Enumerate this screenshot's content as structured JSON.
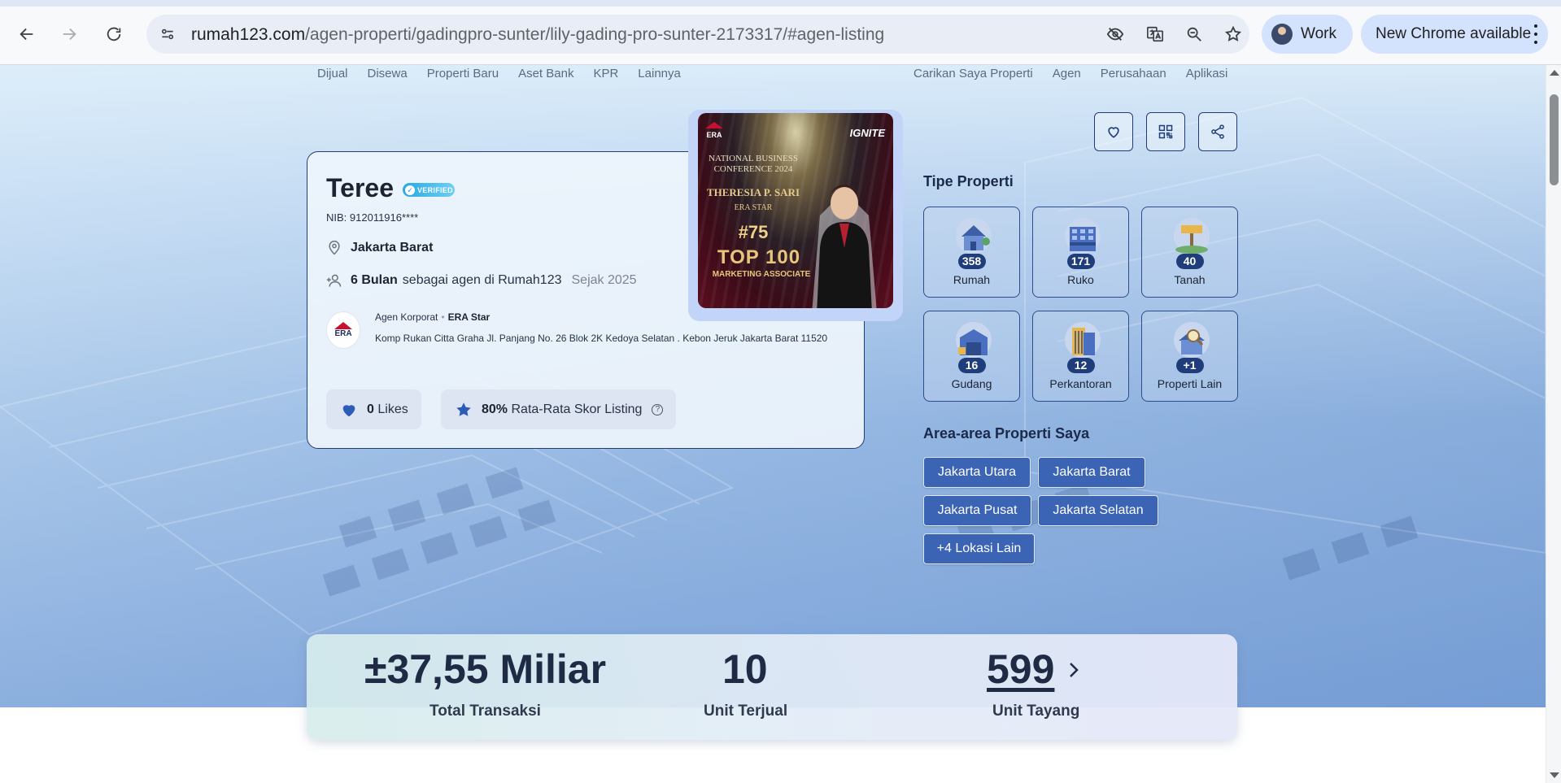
{
  "browser": {
    "url_host": "rumah123.com",
    "url_path": "/agen-properti/gadingpro-sunter/lily-gading-pro-sunter-2173317/#agen-listing",
    "profile_label": "Work",
    "update_label": "New Chrome available",
    "icons": [
      "back-icon",
      "forward-icon",
      "reload-icon",
      "site-info-icon",
      "eye-slash-icon",
      "translate-icon",
      "zoom-icon",
      "star-icon",
      "more-vert-icon"
    ]
  },
  "topnav": {
    "left": [
      "Dijual",
      "Disewa",
      "Properti Baru",
      "Aset Bank",
      "KPR",
      "Lainnya"
    ],
    "right": [
      "Carikan Saya Properti",
      "Agen",
      "Perusahaan",
      "Aplikasi"
    ]
  },
  "agent": {
    "name": "Teree",
    "verified_label": "VERIFIED",
    "nib": "NIB: 912011916****",
    "location": "Jakarta Barat",
    "tenure_bold": "6 Bulan",
    "tenure_text": "sebagai agen di Rumah123",
    "since": "Sejak 2025",
    "agency_type": "Agen Korporat",
    "agency_name": "ERA Star",
    "agency_address": "Komp Rukan Citta Graha Jl. Panjang No. 26 Blok 2K Kedoya Selatan . Kebon Jeruk Jakarta Barat 11520",
    "agency_logo_text": "ERA",
    "likes_count": "0",
    "likes_label": "Likes",
    "score_value": "80%",
    "score_label": "Rata-Rata Skor Listing"
  },
  "award": {
    "brand": "IGNITE",
    "conference": "NATIONAL BUSINESS CONFERENCE 2024",
    "person": "THERESIA P. SARI",
    "office": "ERA STAR",
    "rank": "#75",
    "top": "TOP 100",
    "category": "MARKETING ASSOCIATE"
  },
  "actions": [
    "heart-icon",
    "qr-code-icon",
    "share-icon"
  ],
  "property_types": {
    "title": "Tipe Properti",
    "items": [
      {
        "label": "Rumah",
        "count": "358",
        "icon": "house-icon"
      },
      {
        "label": "Ruko",
        "count": "171",
        "icon": "shophouse-icon"
      },
      {
        "label": "Tanah",
        "count": "40",
        "icon": "land-icon"
      },
      {
        "label": "Gudang",
        "count": "16",
        "icon": "warehouse-icon"
      },
      {
        "label": "Perkantoran",
        "count": "12",
        "icon": "office-icon"
      },
      {
        "label": "Properti Lain",
        "count": "+1",
        "icon": "other-property-icon"
      }
    ]
  },
  "areas": {
    "title": "Area-area Properti Saya",
    "items": [
      "Jakarta Utara",
      "Jakarta Barat",
      "Jakarta Pusat",
      "Jakarta Selatan",
      "+4 Lokasi Lain"
    ]
  },
  "stats": [
    {
      "value": "±37,55 Miliar",
      "label": "Total Transaksi"
    },
    {
      "value": "10",
      "label": "Unit Terjual"
    },
    {
      "value": "599",
      "label": "Unit Tayang"
    }
  ],
  "colors": {
    "primary": "#1f3d7a",
    "area_button": "#3b64b5",
    "verified": "#29a9e0",
    "chrome_chip": "#d3e3fd"
  }
}
